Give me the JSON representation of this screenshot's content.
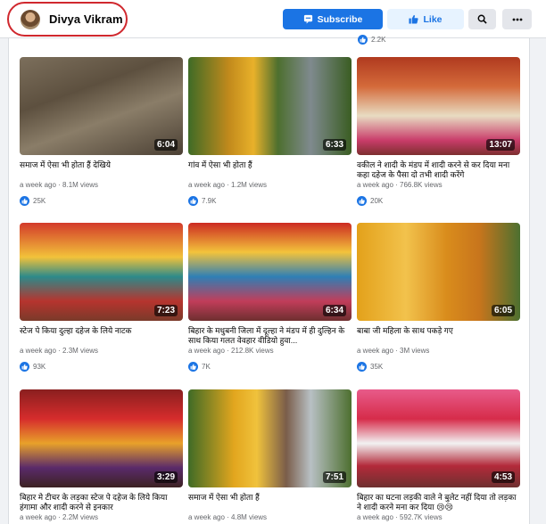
{
  "header": {
    "profile_name": "Divya Vikram",
    "subscribe_label": "Subscribe",
    "like_label": "Like",
    "search_icon": "search-icon",
    "more_icon": "more-icon"
  },
  "top_partial": {
    "likes": "2.2K"
  },
  "colors": {
    "accent": "#1b74e4",
    "highlight_ring": "#d0282e"
  },
  "videos": [
    {
      "title": "समाज में ऐसा भी होता हैं देखिये",
      "meta": "a week ago · 8.1M views",
      "likes": "25K",
      "duration": "6:04"
    },
    {
      "title": "गांव में ऐसा भी होता हैं",
      "meta": "a week ago · 1.2M views",
      "likes": "7.9K",
      "duration": "6:33"
    },
    {
      "title": "वकील ने शादी के मंडप में शादी करने से कर दिया मना कहा दहेज के पैसा दो तभी शादी करेंगे",
      "meta": "a week ago · 766.8K views",
      "likes": "20K",
      "duration": "13:07"
    },
    {
      "title": "स्टेज पे किया दुल्हा दहेज के लिये नाटक",
      "meta": "a week ago · 2.3M views",
      "likes": "93K",
      "duration": "7:23"
    },
    {
      "title": "बिहार के मधुबनी जिला में दूल्हा ने मंडप में ही दुल्हिन के साथ किया गलत वेवहार वीडियो हुवा...",
      "meta": "a week ago · 212.8K views",
      "likes": "7K",
      "duration": "6:34"
    },
    {
      "title": "बाबा जी महिला के साथ पकड़े गए",
      "meta": "a week ago · 3M views",
      "likes": "35K",
      "duration": "6:05"
    },
    {
      "title": "बिहार मे टीचर के लड़का स्टेज पे दहेज के लिये किया हंगामा और शादी करने से इनकार",
      "meta": "a week ago · 2.2M views",
      "likes": "",
      "duration": "3:29"
    },
    {
      "title": "समाज में ऐसा भी होता हैं",
      "meta": "a week ago · 4.8M views",
      "likes": "",
      "duration": "7:51"
    },
    {
      "title": "बिहार का घटना लड़की वाले ने बुलेट नहीं दिया तो लड़का ने शादी करने मना कर दिया 😢😢",
      "meta": "a week ago · 592.7K views",
      "likes": "",
      "duration": "4:53"
    }
  ]
}
